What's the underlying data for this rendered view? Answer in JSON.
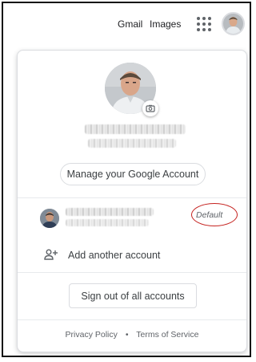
{
  "header": {
    "gmail_label": "Gmail",
    "images_label": "Images",
    "apps_icon": "apps-grid-icon"
  },
  "account_menu": {
    "manage_label": "Manage your Google Account",
    "secondary_account": {
      "default_badge": "Default"
    },
    "add_account_label": "Add another account",
    "add_account_icon": "person-add-icon",
    "sign_out_label": "Sign out of all accounts",
    "footer": {
      "privacy_label": "Privacy Policy",
      "separator": "•",
      "terms_label": "Terms of Service"
    }
  },
  "colors": {
    "annotation_ring": "#c5221f",
    "border": "#dadce0",
    "text": "#3c4043"
  }
}
